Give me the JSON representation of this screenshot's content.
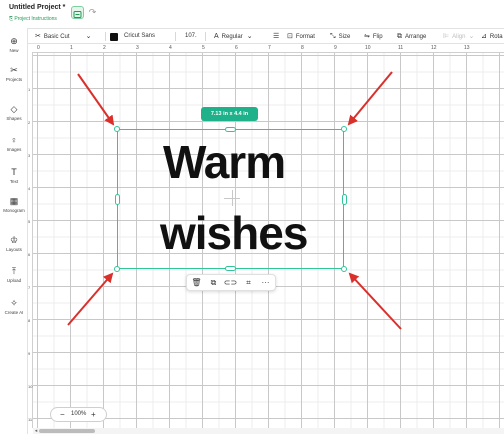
{
  "header": {
    "title": "Untitled Project *",
    "instructions": "Project Instructions"
  },
  "toolbar": {
    "operation": "Basic Cut",
    "font": "Cricut Sans",
    "font_size": "107.",
    "style": "Regular",
    "format": "Format",
    "size": "Size",
    "flip": "Flip",
    "arrange": "Arrange",
    "align": "Align",
    "rotate": "Rota",
    "swatch_color": "#111111"
  },
  "sidebar": {
    "items": [
      {
        "label": "New",
        "icon": "plus-circle-icon"
      },
      {
        "label": "Projects",
        "icon": "projects-icon"
      },
      {
        "label": "Shapes",
        "icon": "shapes-icon"
      },
      {
        "label": "Images",
        "icon": "bulb-icon"
      },
      {
        "label": "Text",
        "icon": "text-icon"
      },
      {
        "label": "Monogram",
        "icon": "monogram-icon"
      },
      {
        "label": "Layouts",
        "icon": "shirt-icon"
      },
      {
        "label": "Upload",
        "icon": "upload-icon"
      },
      {
        "label": "Create AI",
        "icon": "sparkle-icon"
      }
    ]
  },
  "ruler": {
    "top": [
      "0",
      "1",
      "2",
      "3",
      "4",
      "5",
      "6",
      "7",
      "8",
      "9",
      "10",
      "11",
      "12",
      "13"
    ],
    "left": [
      "1",
      "2",
      "3",
      "4",
      "5",
      "6",
      "7",
      "8",
      "9",
      "10",
      "11"
    ]
  },
  "selection": {
    "size_label": "7.13 in x 4.4 in",
    "text_line1": "Warm",
    "text_line2": "wishes",
    "accent_color": "#33c49a"
  },
  "actions": [
    {
      "name": "delete",
      "icon": "trash-icon"
    },
    {
      "name": "duplicate",
      "icon": "duplicate-icon"
    },
    {
      "name": "attach",
      "icon": "link-icon"
    },
    {
      "name": "group",
      "icon": "group-icon"
    },
    {
      "name": "more",
      "icon": "more-icon"
    }
  ],
  "zoom": {
    "minus": "−",
    "value": "100%",
    "plus": "+"
  },
  "annotation_color": "#d9302c"
}
